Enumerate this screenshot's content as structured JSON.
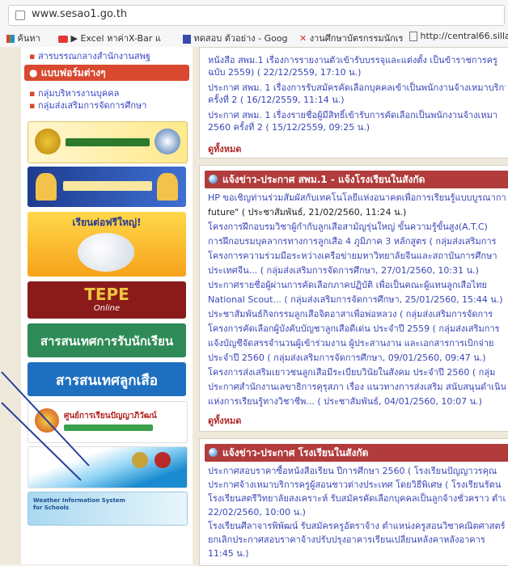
{
  "browser": {
    "url": "www.sesao1.go.th",
    "bookmarks": [
      "ค้นหา",
      "▶ Excel หาค่าX-Bar แ",
      "ทดสอบ ตัวอย่าง - Goog",
      "งานศึกษาบัตรกรรมนักเร",
      "http://central66.silla"
    ],
    "bookmark_colors": [
      "#1a73e8",
      "#e53935",
      "#3949ab",
      "#d32f2f",
      "#555555"
    ]
  },
  "left": {
    "top_link": "สารบรรณกลางสำนักงานสพฐ",
    "forms_title": "แบบฟอร์มต่างๆ",
    "form_links": [
      "กลุ่มบริหารงานบุคคล",
      "กลุ่มส่งเสริมการจัดการศึกษา"
    ],
    "banners": [
      {
        "name": "school-logo-banner",
        "text": ""
      },
      {
        "name": "royal-banner",
        "text": ""
      },
      {
        "name": "piggy-bank-banner",
        "text": "เรียนต่อฟรีใหญ่!"
      },
      {
        "name": "tepe-banner",
        "text": "TEPE",
        "sub": "Online"
      },
      {
        "name": "admission-info-banner",
        "text": "สารสนเทศการรับนักเรียน"
      },
      {
        "name": "scout-info-banner",
        "text": "สารสนเทศลูกเสือ"
      },
      {
        "name": "moral-center-banner",
        "text": "ศูนย์การเรียนปัญญาภิวัฒน์"
      },
      {
        "name": "water-banner",
        "text": ""
      },
      {
        "name": "weather-banner",
        "text": "Weather Information System for Schools"
      }
    ]
  },
  "panel1": {
    "items": [
      {
        "text": "หนังสือ สพม.1 เรื่องการรายงานตัวเข้ารับบรรจุและแต่งตั้ง เป็นข้าราชการครู",
        "color": "#3b46b8"
      },
      {
        "text": "ฉบับ 2559) ( 22/12/2559, 17:10 น.)",
        "color": "#3b46b8"
      },
      {
        "text": "ประกาศ สพม. 1 เรื่องการรับสมัครคัดเลือกบุคคลเข้าเป็นพนักงานจ้างเหมาบริการ",
        "color": "#3b46b8"
      },
      {
        "text": "ครั้งที่ 2 ( 16/12/2559, 11:14 น.)",
        "color": "#3b46b8"
      },
      {
        "text": "ประกาศ สพม. 1 เรื่องรายชื่อผู้มีสิทธิ์เข้ารับการคัดเลือกเป็นพนักงานจ้างเหมา",
        "color": "#3b46b8"
      },
      {
        "text": "2560 ครั้งที่ 2 ( 15/12/2559, 09:25 น.)",
        "color": "#3b46b8"
      }
    ],
    "all_label": "ดูทั้งหมด"
  },
  "panel2": {
    "title": "แจ้งข่าว-ประกาศ สพม.1 - แจ้งโรงเรียนในสังกัด",
    "items": [
      {
        "text": "HP ขอเชิญท่านร่วมสัมผัสกับเทคโนโลยีแห่งอนาคตเพื่อการเรียนรู้แบบบูรณาการ",
        "color": "#3b46b8"
      },
      {
        "text": "future\" ( ประชาสัมพันธ์, 21/02/2560, 11:24 น.)",
        "color": "#222222"
      },
      {
        "text": "โครงการฝึกอบรมวิชาผู้กำกับลูกเสือสามัญรุ่นใหญ่ ขั้นความรู้ขั้นสูง(A.T.C)",
        "color": "#3b46b8"
      },
      {
        "text": "การฝึกอบรมบุคลากรทางการลูกเสือ 4 ภูมิภาค 3 หลักสูตร ( กลุ่มส่งเสริมการ",
        "color": "#3b46b8"
      },
      {
        "text": "โครงการความร่วมมือระหว่างเครือข่ายมหาวิทยาลัยจีนและสถาบันการศึกษา",
        "color": "#3b46b8"
      },
      {
        "text": "ประเทศจีน... ( กลุ่มส่งเสริมการจัดการศึกษา, 27/01/2560, 10:31 น.)",
        "color": "#3b46b8"
      },
      {
        "text": "ประกาศรายชื่อผู้ผ่านการคัดเลือกภาคปฏิบัติ เพื่อเป็นคณะผู้แทนลูกเสือไทย",
        "color": "#3b46b8"
      },
      {
        "text": "National Scout... ( กลุ่มส่งเสริมการจัดการศึกษา, 25/01/2560, 15:44 น.)",
        "color": "#3b46b8"
      },
      {
        "text": "ประชาสัมพันธ์กิจกรรมลูกเสือจิตอาสาเพื่อพ่อหลวง ( กลุ่มส่งเสริมการจัดการ",
        "color": "#3b46b8"
      },
      {
        "text": "โครงการคัดเลือกผู้บังคับบัญชาลูกเสือดีเด่น ประจำปี 2559 ( กลุ่มส่งเสริมการ",
        "color": "#3b46b8"
      },
      {
        "text": "แจ้งบัญชีจัดสรรจำนวนผู้เข้าร่วมงาน ผู้ประสานงาน และเอกสารการเบิกจ่าย",
        "color": "#3b46b8"
      },
      {
        "text": "ประจำปี 2560 ( กลุ่มส่งเสริมการจัดการศึกษา, 09/01/2560, 09:47 น.)",
        "color": "#3b46b8"
      },
      {
        "text": "โครงการส่งเสริมเยาวชนลูกเสือมีระเบียบวินัยในสังคม ประจำปี 2560 ( กลุ่ม",
        "color": "#3b46b8"
      },
      {
        "text": "ประกาศสำนักงานเลขาธิการคุรุสภา เรื่อง แนวทางการส่งเสริม สนับสนุนดำเนินงาน",
        "color": "#3b46b8"
      },
      {
        "text": "แห่งการเรียนรู้ทางวิชาชีพ... ( ประชาสัมพันธ์, 04/01/2560, 10:07 น.)",
        "color": "#3b46b8"
      }
    ],
    "all_label": "ดูทั้งหมด"
  },
  "panel3": {
    "title": "แจ้งข่าว-ประกาศ โรงเรียนในสังกัด",
    "items": [
      {
        "text": "ประกาศสอบราคาซื้อหนังสือเรียน ปีการศึกษา 2560 ( โรงเรียนปัญญาวรคุณ",
        "color": "#3b46b8"
      },
      {
        "text": "ประกาศจ้างเหมาบริการครูผู้สอนชาวต่างประเทศ โดยวิธีพิเศษ ( โรงเรียนรัตน",
        "color": "#3b46b8"
      },
      {
        "text": "โรงเรียนสตรีวิทยาลัยสงเคราะห์ รับสมัครคัดเลือกบุคคลเป็นลูกจ้างชั่วคราว ตำแหน่ง",
        "color": "#3b46b8"
      },
      {
        "text": "22/02/2560, 10:00 น.)",
        "color": "#3b46b8"
      },
      {
        "text": "โรงเรียนศีลาจารพิพัฒน์ รับสมัครครูอัตราจ้าง ตำแหน่งครูสอนวิชาคณิตศาสตร์",
        "color": "#3b46b8"
      },
      {
        "text": "ยกเลิกประกาศสอบราคาจ้างปรับปรุงอาคารเรียนเปลี่ยนหลังคาหลังอาคาร",
        "color": "#3b46b8"
      },
      {
        "text": "11:45 น.)",
        "color": "#3b46b8"
      }
    ]
  }
}
